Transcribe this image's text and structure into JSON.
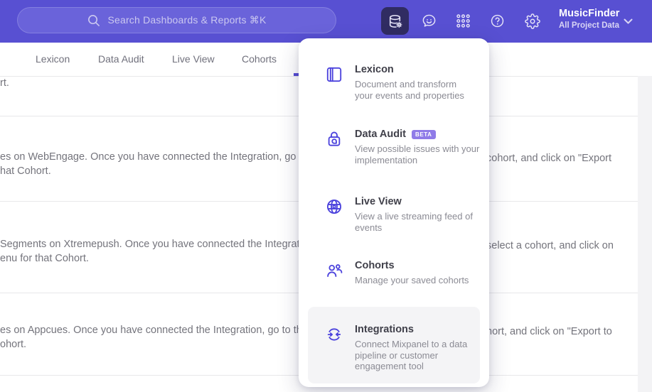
{
  "header": {
    "search": {
      "placeholder": "Search Dashboards & Reports ⌘K",
      "icon": "search-icon"
    },
    "icons": {
      "data_management": "database-gear-icon",
      "feedback": "chat-smiley-icon",
      "apps": "grid-dots-icon",
      "help": "question-mark-icon",
      "settings": "gear-icon",
      "project_chevron": "chevron-down-icon"
    },
    "project": {
      "name": "MusicFinder",
      "subtitle": "All Project Data"
    }
  },
  "tabs": [
    {
      "label": "Lexicon"
    },
    {
      "label": "Data Audit"
    },
    {
      "label": "Live View"
    },
    {
      "label": "Cohorts"
    }
  ],
  "menu": {
    "items": [
      {
        "title": "Lexicon",
        "icon": "book-icon",
        "description": "Document and transform your events and properties"
      },
      {
        "title": "Data Audit",
        "icon": "audit-lock-icon",
        "badge": "BETA",
        "description": "View possible issues with your implementation"
      },
      {
        "title": "Live View",
        "icon": "globe-icon",
        "description": "View a live streaming feed of events"
      },
      {
        "title": "Cohorts",
        "icon": "people-icon",
        "description": "Manage your saved cohorts"
      },
      {
        "title": "Integrations",
        "icon": "sync-arrows-icon",
        "highlighted": true,
        "description": "Connect Mixpanel to a data pipeline or customer engagement tool"
      }
    ]
  },
  "content": {
    "fragments": [
      {
        "text": "rt."
      },
      {
        "text": "es on WebEngage. Once you have connected the Integration, go to the"
      },
      {
        "text": "cohort, and click on \"Export"
      },
      {
        "text": "hat Cohort."
      },
      {
        "text": "Segments on Xtremepush. Once you have connected the Integration, "
      },
      {
        "text": "select a cohort, and click on"
      },
      {
        "text": "enu for that Cohort."
      },
      {
        "text": "es on Appcues. Once you have connected the Integration, go to the M"
      },
      {
        "text": "hort, and click on \"Export to"
      },
      {
        "text": "ohort."
      }
    ]
  },
  "colors": {
    "header_bg": "#5850D2",
    "accent_purple": "#4C43DD",
    "active_icon_bg": "#302C62",
    "beta_badge_bg": "#8F7BE8",
    "menu_hover_bg": "#F4F4F6",
    "tab_underline": "#544BD4"
  }
}
